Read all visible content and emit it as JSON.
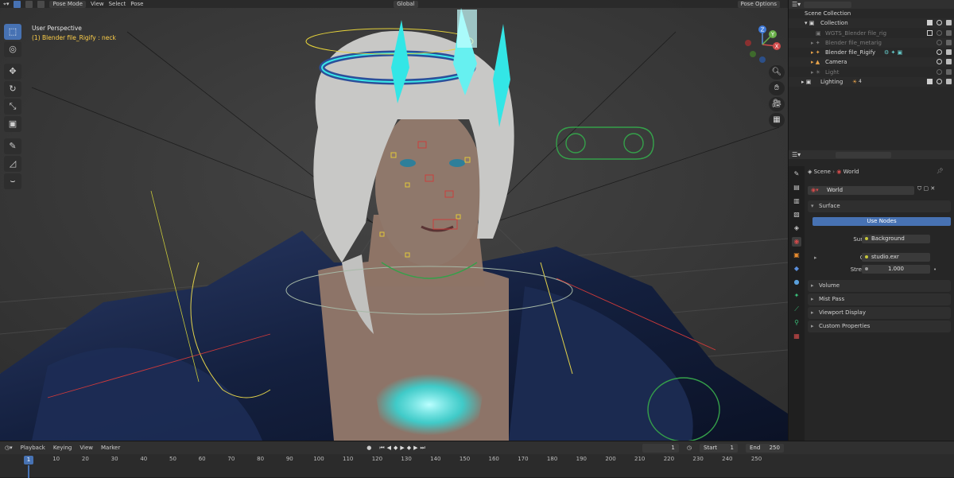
{
  "viewport": {
    "mode_label": "Pose Mode",
    "menus": [
      "View",
      "Select",
      "Pose"
    ],
    "transform_orientation": "Global",
    "pose_options_label": "Pose Options",
    "perspective_label": "User Perspective",
    "active_object_label": "(1) Blender file_Rigify : neck",
    "gizmo_axes": {
      "x": "X",
      "y": "Y",
      "z": "Z"
    },
    "tools": [
      "select-box",
      "cursor",
      "move",
      "rotate",
      "scale",
      "transform",
      "annotate",
      "measure",
      "relax"
    ]
  },
  "outliner": {
    "rows": [
      {
        "label": "Scene Collection",
        "level": 0,
        "dim": false
      },
      {
        "label": "Collection",
        "level": 1,
        "dim": false
      },
      {
        "label": "WGTS_Blender file_rig",
        "level": 2,
        "dim": true
      },
      {
        "label": "Blender file_metarig",
        "level": 2,
        "dim": true
      },
      {
        "label": "Blender file_Rigify",
        "level": 2,
        "dim": false
      },
      {
        "label": "Camera",
        "level": 2,
        "dim": false
      },
      {
        "label": "Light",
        "level": 2,
        "dim": true
      },
      {
        "label": "Lighting",
        "level": 1,
        "dim": false
      }
    ],
    "lighting_count": "4"
  },
  "properties": {
    "breadcrumb": {
      "scene": "Scene",
      "world": "World"
    },
    "world_name": "World",
    "surface_panel": "Surface",
    "use_nodes_label": "Use Nodes",
    "surface_label": "Surface",
    "surface_value": "Background",
    "color_label": "Color",
    "color_value": "studio.exr",
    "strength_label": "Strength",
    "strength_value": "1.000",
    "panels": [
      "Volume",
      "Mist Pass",
      "Viewport Display",
      "Custom Properties"
    ]
  },
  "timeline": {
    "menus": [
      "Playback",
      "Keying",
      "View",
      "Marker"
    ],
    "current_frame": "1",
    "start_label": "Start",
    "start_value": "1",
    "end_label": "End",
    "end_value": "250",
    "ruler_ticks": [
      "1",
      "10",
      "20",
      "30",
      "40",
      "50",
      "60",
      "70",
      "80",
      "90",
      "100",
      "110",
      "120",
      "130",
      "140",
      "150",
      "160",
      "170",
      "180",
      "190",
      "200",
      "210",
      "220",
      "230",
      "240",
      "250"
    ]
  },
  "colors": {
    "accent": "#4772b3",
    "active_text": "#ffd04a",
    "glow": "#33e6e6"
  }
}
